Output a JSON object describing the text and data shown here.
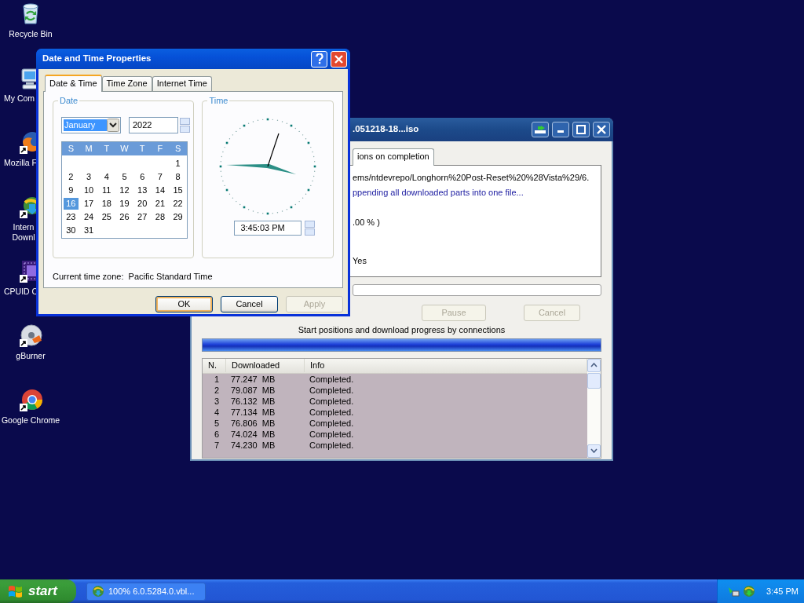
{
  "desktop_icons": [
    {
      "kind": "recycle",
      "label": "Recycle Bin"
    },
    {
      "kind": "computer",
      "label": "My Com"
    },
    {
      "kind": "firefox",
      "label": "Mozilla F"
    },
    {
      "kind": "download",
      "label": "Intern Downl"
    },
    {
      "kind": "chip",
      "label": "CPUID C"
    },
    {
      "kind": "disc",
      "label": "gBurner"
    },
    {
      "kind": "chrome",
      "label": "Google Chrome"
    }
  ],
  "download_window": {
    "title": ".051218-18...iso",
    "tab": "ions on completion",
    "lines": [
      {
        "kind": "url",
        "text": "ems/ntdevrepo/Longhorn%20Post-Reset%20%28Vista%29/6."
      },
      {
        "kind": "status",
        "text": "ppending all downloaded parts into one file..."
      },
      {
        "kind": "plain",
        "text": ".00 % )"
      },
      {
        "kind": "plain",
        "text": "Yes"
      }
    ],
    "buttons": [
      {
        "label": "Pause",
        "disabled": true
      },
      {
        "label": "Cancel",
        "disabled": true
      }
    ],
    "connections_label": "Start positions and download progress by connections",
    "progress": {
      "level": 1
    },
    "table": {
      "columns": [
        "N.",
        "Downloaded",
        "Info"
      ],
      "rows": [
        [
          "1",
          "77.247  MB",
          "Completed."
        ],
        [
          "2",
          "79.087  MB",
          "Completed."
        ],
        [
          "3",
          "76.132  MB",
          "Completed."
        ],
        [
          "4",
          "77.134  MB",
          "Completed."
        ],
        [
          "5",
          "76.806  MB",
          "Completed."
        ],
        [
          "6",
          "74.024  MB",
          "Completed."
        ],
        [
          "7",
          "74.230  MB",
          "Completed."
        ]
      ]
    }
  },
  "dialog": {
    "title": "Date and Time Properties",
    "tabs": [
      {
        "label": "Date & Time",
        "selected": true
      },
      {
        "label": "Time Zone",
        "selected": false
      },
      {
        "label": "Internet Time",
        "selected": false
      }
    ],
    "date_group": {
      "legend": "Date",
      "month": "January",
      "year": "2022",
      "weekdays": [
        "S",
        "M",
        "T",
        "W",
        "T",
        "F",
        "S"
      ],
      "weeks": [
        [
          {
            "day": "1",
            "selected": false
          }
        ],
        [
          {
            "day": "2",
            "selected": false
          },
          {
            "day": "3",
            "selected": false
          },
          {
            "day": "4",
            "selected": false
          },
          {
            "day": "5",
            "selected": false
          },
          {
            "day": "6",
            "selected": false
          },
          {
            "day": "7",
            "selected": false
          },
          {
            "day": "8",
            "selected": false
          }
        ],
        [
          {
            "day": "9",
            "selected": false
          },
          {
            "day": "10",
            "selected": false
          },
          {
            "day": "11",
            "selected": false
          },
          {
            "day": "12",
            "selected": false
          },
          {
            "day": "13",
            "selected": false
          },
          {
            "day": "14",
            "selected": false
          },
          {
            "day": "15",
            "selected": false
          }
        ],
        [
          {
            "day": "16",
            "selected": true
          },
          {
            "day": "17",
            "selected": false
          },
          {
            "day": "18",
            "selected": false
          },
          {
            "day": "19",
            "selected": false
          },
          {
            "day": "20",
            "selected": false
          },
          {
            "day": "21",
            "selected": false
          },
          {
            "day": "22",
            "selected": false
          }
        ],
        [
          {
            "day": "23",
            "selected": false
          },
          {
            "day": "24",
            "selected": false
          },
          {
            "day": "25",
            "selected": false
          },
          {
            "day": "26",
            "selected": false
          },
          {
            "day": "27",
            "selected": false
          },
          {
            "day": "28",
            "selected": false
          },
          {
            "day": "29",
            "selected": false
          }
        ],
        [
          {
            "day": "30",
            "selected": false
          },
          {
            "day": "31",
            "selected": false
          }
        ]
      ]
    },
    "time_group": {
      "legend": "Time",
      "time": "3:45:03 PM"
    },
    "time_zone": "Current time zone:  Pacific Standard Time",
    "buttons": [
      {
        "label": "OK",
        "disabled": false,
        "default": true
      },
      {
        "label": "Cancel",
        "disabled": false,
        "default": false
      },
      {
        "label": "Apply",
        "disabled": true,
        "default": false
      }
    ]
  },
  "taskbar": {
    "start": "start",
    "tasks": [
      {
        "label": "100% 6.0.5284.0.vbl..."
      }
    ],
    "clock": "3:45 PM"
  }
}
